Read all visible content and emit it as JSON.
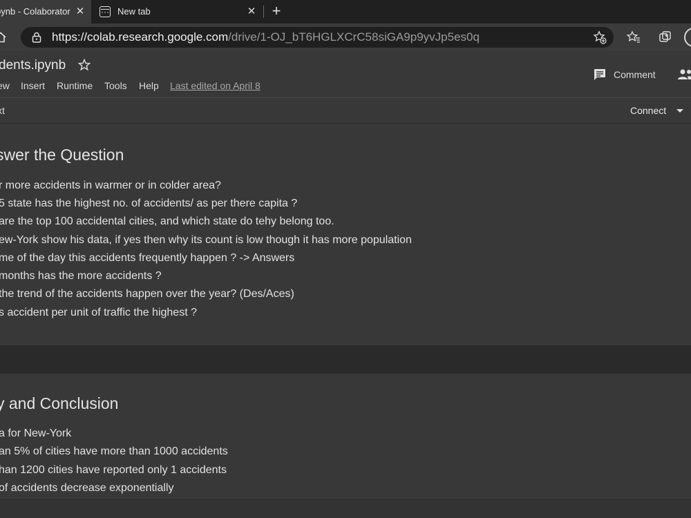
{
  "browser": {
    "tabs": [
      {
        "title": "pynb - Colaborator",
        "active": true
      },
      {
        "title": "New tab",
        "active": false
      }
    ],
    "new_tab_label": "+",
    "address": {
      "host": "https://colab.research.google.com",
      "path": "/drive/1-OJ_bT6HGLXCrC58siGA9p9yvJp5es0q"
    }
  },
  "colab": {
    "notebook_title": "dents.ipynb",
    "menu": [
      "ew",
      "Insert",
      "Runtime",
      "Tools",
      "Help"
    ],
    "last_edited": "Last edited on April 8",
    "comment_label": "Comment",
    "text_button": "xt",
    "connect_label": "Connect"
  },
  "cells": [
    {
      "heading": "swer the Question",
      "lines": [
        "r more accidents in warmer or in colder area?",
        "5 state has the highest no. of accidents/ as per there capita ?",
        "are the top 100 accidental cities, and which state do tehy belong too.",
        "ew-York show his data, if yes then why its count is low though it has more population",
        "me of the day this accidents frequently happen ? -> Answers",
        "months has the more accidents ?",
        " the trend of the accidents happen over the year? (Des/Aces)",
        "s accident per unit of traffic the highest ?"
      ]
    },
    {
      "heading": "y and Conclusion",
      "lines": [
        "a for New-York",
        "an 5% of cities have more than 1000 accidents",
        "han 1200 cities have reported only 1 accidents",
        " of accidents decrease exponentially"
      ]
    }
  ]
}
